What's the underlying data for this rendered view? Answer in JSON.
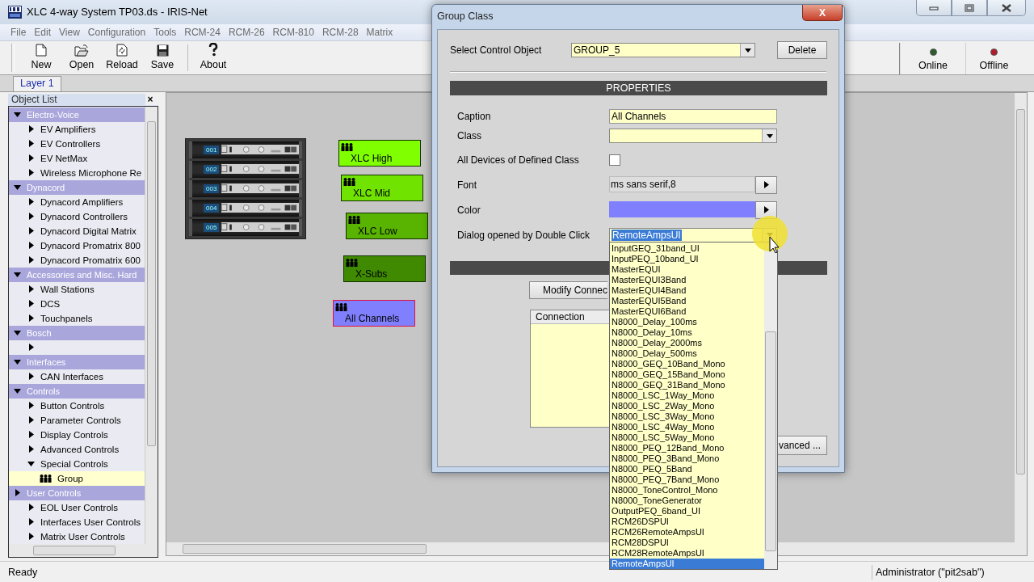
{
  "window": {
    "title": "XLC 4-way System TP03.ds - IRIS-Net"
  },
  "menu": [
    "File",
    "Edit",
    "View",
    "Configuration",
    "Tools",
    "RCM-24",
    "RCM-26",
    "RCM-810",
    "RCM-28",
    "Matrix"
  ],
  "toolbar": [
    {
      "label": "New"
    },
    {
      "label": "Open"
    },
    {
      "label": "Reload"
    },
    {
      "label": "Save"
    },
    {
      "label": "About"
    }
  ],
  "connection_buttons": [
    {
      "label": "Online",
      "color": "#2e5a2e"
    },
    {
      "label": "Offline",
      "color": "#b01c2e"
    }
  ],
  "tabs": [
    {
      "label": "Layer 1",
      "selected": true
    }
  ],
  "object_list": {
    "title": "Object List",
    "close": "×",
    "groups": [
      {
        "label": "Electro-Voice",
        "expanded": true,
        "children": [
          {
            "label": "EV Amplifiers",
            "expanded": false
          },
          {
            "label": "EV Controllers",
            "expanded": false
          },
          {
            "label": "EV NetMax",
            "expanded": false
          },
          {
            "label": "Wireless Microphone Re",
            "expanded": false
          }
        ]
      },
      {
        "label": "Dynacord",
        "expanded": true,
        "children": [
          {
            "label": "Dynacord Amplifiers",
            "expanded": false
          },
          {
            "label": "Dynacord Controllers",
            "expanded": false
          },
          {
            "label": "Dynacord Digital Matrix",
            "expanded": false
          },
          {
            "label": "Dynacord Promatrix 800",
            "expanded": false
          },
          {
            "label": "Dynacord Promatrix 600",
            "expanded": false
          }
        ]
      },
      {
        "label": "Accessories and Misc. Hard",
        "expanded": true,
        "children": [
          {
            "label": "Wall Stations",
            "expanded": false
          },
          {
            "label": "DCS",
            "expanded": false
          },
          {
            "label": "Touchpanels",
            "expanded": false
          }
        ]
      },
      {
        "label": "Bosch",
        "expanded": true,
        "children": [
          {
            "expanded": false
          }
        ]
      },
      {
        "label": "Interfaces",
        "expanded": true,
        "children": [
          {
            "label": "CAN Interfaces",
            "expanded": false
          }
        ]
      },
      {
        "label": "Controls",
        "expanded": true,
        "children": [
          {
            "label": "Button Controls",
            "expanded": false
          },
          {
            "label": "Parameter Controls",
            "expanded": false
          },
          {
            "label": "Display Controls",
            "expanded": false
          },
          {
            "label": "Advanced Controls",
            "expanded": false
          },
          {
            "label": "Special Controls",
            "expanded": true,
            "children": [
              {
                "label": "Group",
                "kind": "group",
                "selected": true
              }
            ]
          }
        ]
      },
      {
        "label": "User Controls",
        "expanded": false,
        "children": [
          {
            "label": "EOL User Controls",
            "expanded": false
          },
          {
            "label": "Interfaces User Controls",
            "expanded": false
          },
          {
            "label": "Matrix User Controls",
            "expanded": false
          }
        ]
      }
    ]
  },
  "canvas": {
    "amplifiers": [
      {
        "number": "001"
      },
      {
        "number": "002"
      },
      {
        "number": "003"
      },
      {
        "number": "004"
      },
      {
        "number": "005"
      }
    ],
    "groups": [
      {
        "label": "XLC High",
        "color": "#80ff00",
        "selected": false
      },
      {
        "label": "XLC Mid",
        "color": "#70e400",
        "selected": false
      },
      {
        "label": "XLC Low",
        "color": "#58b400",
        "selected": false
      },
      {
        "label": "X-Subs",
        "color": "#3f8a00",
        "selected": false
      },
      {
        "label": "All Channels",
        "color": "#8080ff",
        "selected": true
      }
    ]
  },
  "dialog": {
    "title": "Group Class",
    "close": "X",
    "select_control_object": {
      "label": "Select Control Object",
      "value": "GROUP_5"
    },
    "delete_button": "Delete",
    "properties_header": "PROPERTIES",
    "properties": [
      {
        "kind": "text",
        "label": "Caption",
        "value": "All Channels"
      },
      {
        "kind": "combo",
        "label": "Class"
      },
      {
        "kind": "checkbox",
        "label": "All Devices of Defined Class",
        "checked": false
      },
      {
        "kind": "picker",
        "label": "Font",
        "value": "ms sans serif,8"
      },
      {
        "kind": "color",
        "label": "Color",
        "color": "#8080ff"
      },
      {
        "kind": "combo",
        "label": "Dialog opened by Double Click",
        "value": "RemoteAmpsUI",
        "highlighted": true,
        "open": true,
        "options": [
          {
            "label": "InputGEQ_31band_UI",
            "selected": false
          },
          {
            "label": "InputPEQ_10band_UI",
            "selected": false
          },
          {
            "label": "MasterEQUI",
            "selected": false
          },
          {
            "label": "MasterEQUI3Band",
            "selected": false
          },
          {
            "label": "MasterEQUI4Band",
            "selected": false
          },
          {
            "label": "MasterEQUI5Band",
            "selected": false
          },
          {
            "label": "MasterEQUI6Band",
            "selected": false
          },
          {
            "label": "N8000_Delay_100ms",
            "selected": false
          },
          {
            "label": "N8000_Delay_10ms",
            "selected": false
          },
          {
            "label": "N8000_Delay_2000ms",
            "selected": false
          },
          {
            "label": "N8000_Delay_500ms",
            "selected": false
          },
          {
            "label": "N8000_GEQ_10Band_Mono",
            "selected": false
          },
          {
            "label": "N8000_GEQ_15Band_Mono",
            "selected": false
          },
          {
            "label": "N8000_GEQ_31Band_Mono",
            "selected": false
          },
          {
            "label": "N8000_LSC_1Way_Mono",
            "selected": false
          },
          {
            "label": "N8000_LSC_2Way_Mono",
            "selected": false
          },
          {
            "label": "N8000_LSC_3Way_Mono",
            "selected": false
          },
          {
            "label": "N8000_LSC_4Way_Mono",
            "selected": false
          },
          {
            "label": "N8000_LSC_5Way_Mono",
            "selected": false
          },
          {
            "label": "N8000_PEQ_12Band_Mono",
            "selected": false
          },
          {
            "label": "N8000_PEQ_3Band_Mono",
            "selected": false
          },
          {
            "label": "N8000_PEQ_5Band",
            "selected": false
          },
          {
            "label": "N8000_PEQ_7Band_Mono",
            "selected": false
          },
          {
            "label": "N8000_ToneControl_Mono",
            "selected": false
          },
          {
            "label": "N8000_ToneGenerator",
            "selected": false
          },
          {
            "label": "OutputPEQ_6band_UI",
            "selected": false
          },
          {
            "label": "RCM26DSPUI",
            "selected": false
          },
          {
            "label": "RCM26RemoteAmpsUI",
            "selected": false
          },
          {
            "label": "RCM28DSPUI",
            "selected": false
          },
          {
            "label": "RCM28RemoteAmpsUI",
            "selected": false
          },
          {
            "label": "RemoteAmpsUI",
            "selected": true
          }
        ]
      }
    ],
    "modify_button": "Modify Connec",
    "connections": {
      "columns": [
        "Connection"
      ]
    },
    "advanced_button": "vanced ..."
  },
  "status_bar": {
    "message": "Ready",
    "user": "Administrator (\"pit2sab\")"
  }
}
